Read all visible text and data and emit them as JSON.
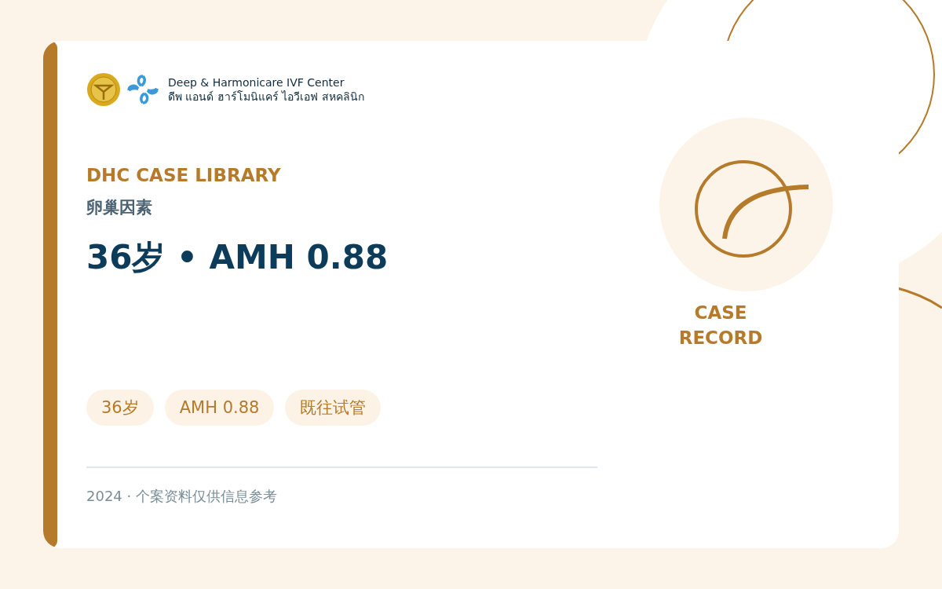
{
  "logo": {
    "name_en": "Deep & Harmonicare IVF Center",
    "name_th": "ดีพ แอนด์ ฮาร์โมนิแคร์ ไอวีเอฟ สหคลินิก"
  },
  "eyebrow": "DHC CASE LIBRARY",
  "category": "卵巢因素",
  "title": "36岁 • AMH 0.88",
  "tags": [
    "36岁",
    "AMH 0.88",
    "既往试管"
  ],
  "footer": "2024 · 个案资料仅供信息参考",
  "badge": "CASE RECORD"
}
